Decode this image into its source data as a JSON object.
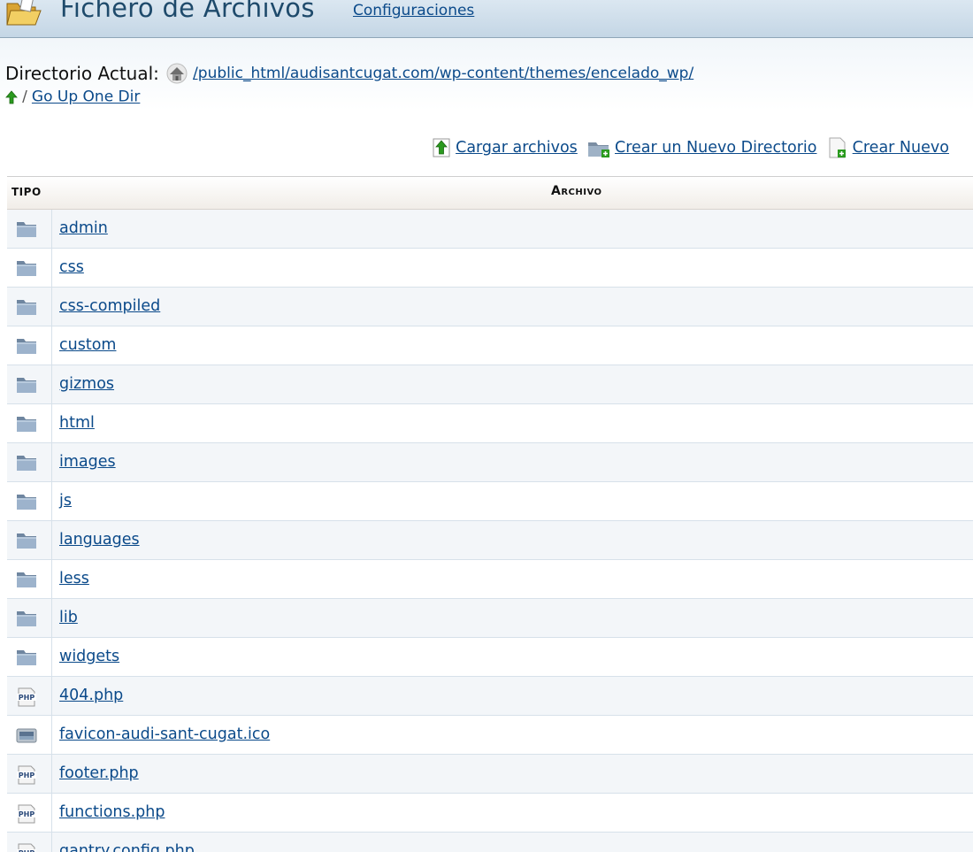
{
  "header": {
    "title": "Fichero de Archivos",
    "settings_link": "Configuraciones",
    "icon": "folder-open-icon"
  },
  "directory": {
    "label": "Directorio Actual:",
    "path": "/public_html/audisantcugat.com/wp-content/themes/encelado_wp/",
    "home_icon": "home-icon",
    "up_slash": "/",
    "up_link": "Go Up One Dir"
  },
  "actions": {
    "upload": "Cargar archivos",
    "new_dir": "Crear un Nuevo Directorio",
    "new_file": "Crear Nuevo"
  },
  "table": {
    "col_type": "TIPO",
    "col_file": "Archivo",
    "rows": [
      {
        "type": "folder",
        "name": "admin"
      },
      {
        "type": "folder",
        "name": "css"
      },
      {
        "type": "folder",
        "name": "css-compiled"
      },
      {
        "type": "folder",
        "name": "custom"
      },
      {
        "type": "folder",
        "name": "gizmos"
      },
      {
        "type": "folder",
        "name": "html"
      },
      {
        "type": "folder",
        "name": "images"
      },
      {
        "type": "folder",
        "name": "js"
      },
      {
        "type": "folder",
        "name": "languages"
      },
      {
        "type": "folder",
        "name": "less"
      },
      {
        "type": "folder",
        "name": "lib"
      },
      {
        "type": "folder",
        "name": "widgets"
      },
      {
        "type": "php",
        "name": "404.php"
      },
      {
        "type": "image",
        "name": "favicon-audi-sant-cugat.ico"
      },
      {
        "type": "php",
        "name": "footer.php"
      },
      {
        "type": "php",
        "name": "functions.php"
      },
      {
        "type": "php",
        "name": "gantry.config.php"
      }
    ]
  },
  "colors": {
    "link": "#0b4a8a",
    "header_bg": "#c4d6e5",
    "row_alt": "#f3f6f9",
    "row_border": "#d7e1ea"
  }
}
